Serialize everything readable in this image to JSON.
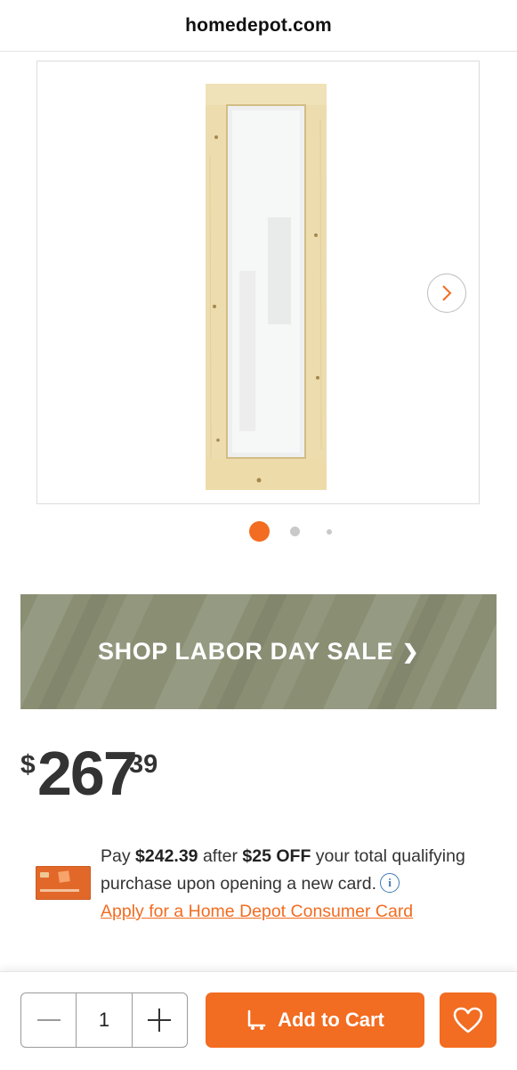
{
  "browser": {
    "url": "homedepot.com"
  },
  "gallery": {
    "active_index": 1,
    "total_dots": 3
  },
  "promo": {
    "label": "SHOP LABOR DAY SALE",
    "chevron": "❯"
  },
  "price": {
    "currency": "$",
    "dollars": "267",
    "cents": "39"
  },
  "card_offer": {
    "pay_prefix": "Pay",
    "pay_amount": "$242.39",
    "after": "after",
    "discount": "$25 OFF",
    "rest": "your total qualifying purchase upon opening a new card.",
    "info_glyph": "i",
    "apply_link": "Apply for a Home Depot Consumer Card"
  },
  "cart_bar": {
    "quantity": "1",
    "add_to_cart_label": "Add to Cart"
  },
  "icons": {
    "next": "chevron-right-icon",
    "minus": "minus-icon",
    "plus": "plus-icon",
    "cart": "dolly-cart-icon",
    "favorite": "heart-icon",
    "info": "info-icon"
  },
  "colors": {
    "accent": "#f26c21",
    "banner": "#8a8f74",
    "link_info": "#3e7ab5"
  }
}
